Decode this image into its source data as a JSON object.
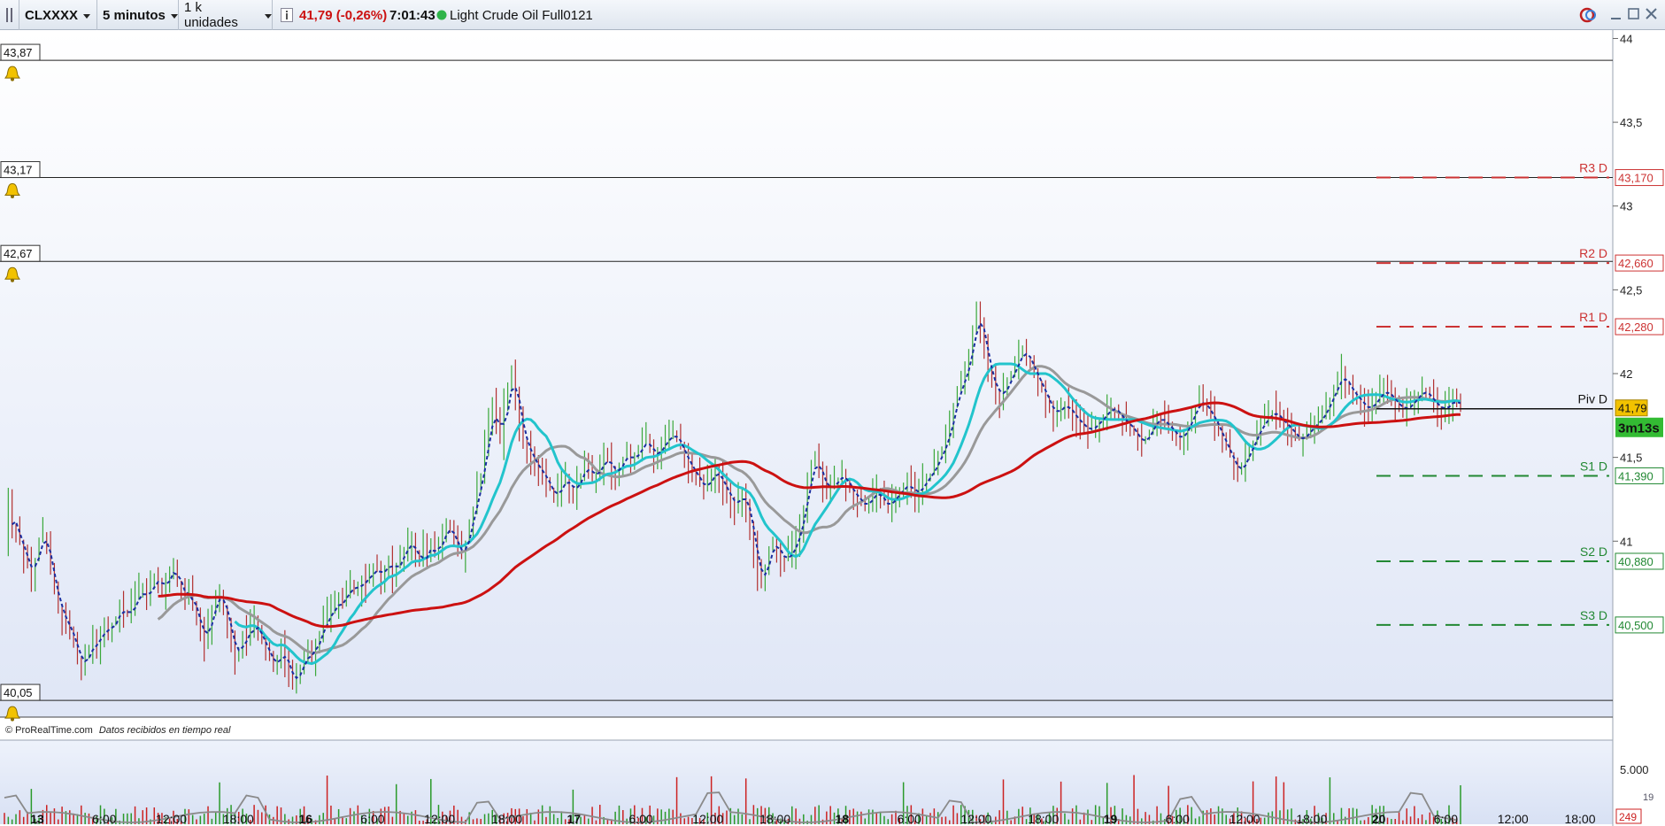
{
  "toolbar": {
    "symbol": "CLXXXX",
    "timeframe": "5 minutos",
    "units": "1 k unidades",
    "price_change": "41,79 (-0,26%)",
    "time": "7:01:43",
    "instrument": "Light Crude Oil Full0121"
  },
  "footer": {
    "source": "© ProRealTime.com",
    "note": "Datos recibidos en tiempo real"
  },
  "countdown": "3m13s",
  "current_price": "41,79",
  "alerts": [
    "43,87",
    "43,17",
    "42,67",
    "40,05"
  ],
  "volume_axis": {
    "tick": "5.000",
    "small_label": "19",
    "current": "249"
  },
  "colors": {
    "accent_red": "#cc1111",
    "resistance": "#cc3333",
    "support": "#228833",
    "cyan": "#22c4cc",
    "gray": "#999999",
    "blue_dash": "#1a2ea0",
    "price_badge": "#f2c200",
    "countdown_bg": "#33bb33"
  },
  "chart_data": {
    "type": "line",
    "y_ticks": [
      "44",
      "43,5",
      "43",
      "42,5",
      "42",
      "41,5",
      "41"
    ],
    "ylim": [
      39.95,
      44.05
    ],
    "x_ticks": [
      {
        "label": "13",
        "bold": true
      },
      {
        "label": "6:00"
      },
      {
        "label": "12:00"
      },
      {
        "label": "18:00"
      },
      {
        "label": "16",
        "bold": true
      },
      {
        "label": "6:00"
      },
      {
        "label": "12:00"
      },
      {
        "label": "18:00"
      },
      {
        "label": "17",
        "bold": true
      },
      {
        "label": "6:00"
      },
      {
        "label": "12:00"
      },
      {
        "label": "18:00"
      },
      {
        "label": "18",
        "bold": true
      },
      {
        "label": "6:00"
      },
      {
        "label": "12:00"
      },
      {
        "label": "18:00"
      },
      {
        "label": "19",
        "bold": true
      },
      {
        "label": "6:00"
      },
      {
        "label": "12:00"
      },
      {
        "label": "18:00"
      },
      {
        "label": "20",
        "bold": true
      },
      {
        "label": "6:00"
      },
      {
        "label": "12:00"
      },
      {
        "label": "18:00"
      }
    ],
    "pivots": [
      {
        "name": "R3 D",
        "value": 43.17,
        "label": "43,170",
        "kind": "resistance"
      },
      {
        "name": "R2 D",
        "value": 42.66,
        "label": "42,660",
        "kind": "resistance"
      },
      {
        "name": "R1 D",
        "value": 42.28,
        "label": "42,280",
        "kind": "resistance"
      },
      {
        "name": "Piv D",
        "value": 41.79,
        "label": "",
        "kind": "pivot"
      },
      {
        "name": "S1 D",
        "value": 41.39,
        "label": "41,390",
        "kind": "support"
      },
      {
        "name": "S2 D",
        "value": 40.88,
        "label": "40,880",
        "kind": "support"
      },
      {
        "name": "S3 D",
        "value": 40.5,
        "label": "40,500",
        "kind": "support"
      }
    ],
    "alert_levels": [
      43.87,
      43.17,
      42.67,
      40.05
    ],
    "price": {
      "x": [
        0,
        2,
        4,
        6,
        8,
        10,
        12,
        14,
        16,
        18,
        20,
        22,
        24,
        26,
        28,
        30,
        32,
        34,
        36,
        38,
        40,
        42,
        44,
        46,
        48,
        50,
        52,
        54,
        56,
        58,
        60,
        62,
        64,
        66,
        68,
        70,
        72,
        74,
        76,
        78,
        80,
        82,
        84,
        86,
        88,
        90,
        92,
        94,
        96,
        98,
        100,
        102,
        104,
        106,
        108,
        110,
        112,
        114,
        116,
        118,
        120,
        122,
        124,
        126,
        128,
        130,
        132,
        134,
        136,
        138,
        140,
        142,
        144,
        146,
        148,
        150,
        152,
        154,
        156,
        158,
        160,
        162,
        164,
        166,
        168,
        170,
        172,
        174,
        176,
        178,
        180,
        182,
        184,
        186,
        188,
        190,
        192,
        194,
        196,
        198,
        200,
        202,
        204,
        206,
        208,
        210,
        212,
        214,
        216,
        218,
        220,
        222,
        224,
        226,
        228,
        230,
        232,
        234,
        236,
        238,
        240,
        242,
        244,
        246,
        248,
        250,
        252,
        254,
        256,
        258,
        260,
        262,
        264,
        266,
        268,
        270,
        272,
        274,
        276,
        278,
        280,
        282,
        284,
        286,
        288,
        290,
        292,
        294,
        296,
        298,
        300,
        302,
        304,
        306,
        308,
        310,
        312,
        314,
        316,
        318,
        320,
        322,
        324,
        326,
        328,
        330,
        332,
        334,
        336,
        338,
        340,
        342,
        344,
        346,
        348,
        350,
        352,
        354,
        356,
        358,
        360,
        362,
        364,
        366,
        368,
        370,
        372,
        374,
        376,
        378,
        380,
        382,
        384,
        386,
        388,
        390,
        392,
        394,
        396,
        398,
        400,
        402,
        404,
        406,
        408,
        410,
        412,
        414,
        416,
        418,
        420,
        422,
        424,
        426,
        428,
        430,
        432,
        434,
        436,
        438,
        440,
        442,
        444,
        446,
        448,
        450,
        452,
        454,
        456,
        458,
        460,
        462,
        464,
        466,
        468,
        470,
        472,
        474,
        476,
        478,
        480,
        482,
        484,
        486,
        488,
        490,
        492,
        494,
        496,
        498,
        500,
        502,
        504,
        506,
        508,
        510,
        512,
        514,
        516,
        518,
        520,
        522,
        524,
        526,
        528,
        530,
        532,
        534,
        536,
        538,
        540,
        542,
        544,
        546,
        548,
        550,
        552,
        554,
        556,
        558,
        560,
        562,
        564,
        566,
        568,
        570,
        572,
        574,
        576,
        578,
        580,
        582,
        584,
        586,
        588,
        590,
        592,
        594,
        596,
        598,
        600,
        602,
        604,
        606,
        608,
        610,
        612,
        614,
        616,
        618,
        620,
        622,
        624,
        626,
        628,
        630,
        632,
        634,
        636,
        638,
        640,
        642,
        644,
        646,
        648,
        650,
        652,
        654,
        656,
        658,
        660,
        662,
        664,
        666,
        668,
        670,
        672,
        674,
        676,
        678,
        680,
        682,
        684,
        686,
        688,
        690,
        692,
        694,
        696,
        698,
        700,
        702,
        704,
        706,
        708,
        710,
        712,
        714,
        716,
        718,
        720,
        722,
        724,
        726,
        728,
        730,
        732,
        734,
        736,
        738,
        740,
        742,
        744,
        746,
        748,
        750,
        752,
        754,
        756,
        758,
        760,
        762,
        764,
        766,
        768,
        770,
        772,
        774,
        776,
        778,
        780,
        782,
        784,
        786,
        788,
        790,
        792,
        794,
        796,
        798,
        800,
        802,
        804,
        806,
        808,
        810,
        812,
        814,
        816,
        818,
        820,
        822,
        824,
        826,
        828,
        830,
        832,
        834,
        836,
        838,
        840,
        842,
        844,
        846,
        848,
        850,
        852,
        854,
        856,
        858,
        860,
        862,
        864,
        866,
        868,
        870,
        872,
        874,
        876,
        878,
        880,
        882,
        884,
        886,
        888,
        890,
        892,
        894,
        896,
        898,
        900,
        902,
        904,
        906,
        908,
        910,
        912,
        914,
        916,
        918,
        920,
        922,
        924,
        926,
        928,
        930,
        932,
        934,
        936,
        938,
        940,
        942,
        944,
        946,
        948,
        950,
        952,
        954,
        956,
        958,
        960,
        962,
        964,
        966,
        968,
        970,
        972,
        974,
        976,
        978,
        980,
        982,
        984,
        986,
        988,
        990,
        992,
        994,
        996,
        998,
        1000,
        1002,
        1004,
        1006,
        1008,
        1010,
        1012,
        1014,
        1016,
        1018,
        1020,
        1022,
        1024,
        1026,
        1028,
        1030,
        1032,
        1034,
        1036,
        1038,
        1040,
        1042,
        1044,
        1046,
        1048,
        1050,
        1052,
        1054,
        1056,
        1058,
        1060,
        1062,
        1064,
        1066,
        1068,
        1070,
        1072,
        1074,
        1076,
        1078,
        1080,
        1082,
        1084,
        1086,
        1088,
        1090,
        1092,
        1094,
        1096,
        1098,
        1100,
        1102,
        1104,
        1106,
        1108,
        1110,
        1112,
        1114,
        1116,
        1118,
        1120,
        1122,
        1124,
        1126,
        1128,
        1130,
        1132,
        1134,
        1136,
        1138,
        1140,
        1142,
        1144,
        1146,
        1148,
        1150,
        1152,
        1154,
        1156,
        1158,
        1160,
        1162,
        1164,
        1166,
        1168,
        1170,
        1172,
        1174,
        1176,
        1178,
        1180,
        1182,
        1184,
        1186,
        1188,
        1190,
        1192,
        1194,
        1196,
        1198,
        1200,
        1202,
        1204,
        1206,
        1208,
        1210,
        1212,
        1214,
        1216,
        1218,
        1220,
        1222,
        1224,
        1226,
        1228,
        1230,
        1232,
        1234,
        1236,
        1238,
        1240,
        1242,
        1244,
        1246,
        1248,
        1250,
        1252,
        1254,
        1256,
        1258,
        1260,
        1262,
        1264,
        1266,
        1268,
        1270,
        1272,
        1274,
        1276,
        1278,
        1280,
        1282,
        1284,
        1286,
        1288,
        1290,
        1292,
        1294,
        1296,
        1298,
        1300,
        1302,
        1304,
        1306,
        1308,
        1310,
        1312,
        1314,
        1316,
        1318,
        1320,
        1322,
        1324,
        1326,
        1328,
        1330,
        1332,
        1334,
        1336,
        1338,
        1340,
        1342,
        1344,
        1346,
        1348,
        1350,
        1352,
        1354,
        1356,
        1358,
        1360,
        1362,
        1364,
        1366,
        1368,
        1370
      ],
      "note_x": "index",
      "y": [
        41.0,
        41.2,
        41.1,
        41.05,
        41.0,
        40.9,
        40.85,
        40.8,
        40.9,
        41.0,
        41.05,
        40.95,
        40.8,
        40.7,
        40.6,
        40.55,
        40.5,
        40.45,
        40.4,
        40.3,
        40.25,
        40.3,
        40.35,
        40.4,
        40.38,
        40.45,
        40.5,
        40.45,
        40.5,
        40.55,
        40.6,
        40.58,
        40.55,
        40.6,
        40.65,
        40.7,
        40.7,
        40.65,
        40.72,
        40.8,
        40.75,
        40.7,
        40.78,
        40.8,
        40.85,
        40.75,
        40.7,
        40.65,
        40.7,
        40.6,
        40.55,
        40.45,
        40.4,
        40.5,
        40.6,
        40.65,
        40.7,
        40.6,
        40.5,
        40.4,
        40.3,
        40.35,
        40.45,
        40.4,
        40.5,
        40.5,
        40.45,
        40.4,
        40.35,
        40.3,
        40.25,
        40.28,
        40.35,
        40.3,
        40.2,
        40.15,
        40.2,
        40.25,
        40.3,
        40.35,
        40.3,
        40.4,
        40.45,
        40.5,
        40.55,
        40.6,
        40.6,
        40.65,
        40.62,
        40.7,
        40.75,
        40.7,
        40.72,
        40.78,
        40.75,
        40.8,
        40.85,
        40.82,
        40.78,
        40.85,
        40.9,
        40.8,
        40.85,
        40.9,
        40.95,
        40.98,
        41.0,
        40.9,
        40.85,
        40.95,
        40.9,
        41.0,
        40.92,
        40.95,
        41.05,
        41.1,
        41.05,
        41.0,
        40.95,
        40.9,
        41.0,
        41.1,
        41.2,
        41.3,
        41.4,
        41.55,
        41.7,
        41.8,
        41.7,
        41.6,
        41.8,
        41.9,
        42.0,
        41.85,
        41.7,
        41.6,
        41.55,
        41.5,
        41.45,
        41.42,
        41.4,
        41.35,
        41.3,
        41.25,
        41.3,
        41.35,
        41.38,
        41.32,
        41.28,
        41.35,
        41.4,
        41.45,
        41.42,
        41.38,
        41.4,
        41.45,
        41.5,
        41.48,
        41.42,
        41.4,
        41.45,
        41.5,
        41.52,
        41.48,
        41.5,
        41.55,
        41.58,
        41.6,
        41.55,
        41.5,
        41.52,
        41.58,
        41.6,
        41.62,
        41.65,
        41.6,
        41.55,
        41.5,
        41.45,
        41.42,
        41.38,
        41.35,
        41.3,
        41.35,
        41.4,
        41.42,
        41.38,
        41.32,
        41.28,
        41.25,
        41.2,
        41.25,
        41.3,
        41.2,
        41.1,
        40.95,
        40.8,
        40.75,
        40.85,
        40.95,
        41.0,
        40.95,
        40.9,
        40.88,
        40.92,
        40.95,
        41.0,
        41.1,
        41.2,
        41.35,
        41.45,
        41.5,
        41.4,
        41.35,
        41.3,
        41.32,
        41.35,
        41.38,
        41.4,
        41.35,
        41.3,
        41.28,
        41.25,
        41.22,
        41.2,
        41.25,
        41.28,
        41.3,
        41.25,
        41.22,
        41.2,
        41.25,
        41.28,
        41.3,
        41.32,
        41.35,
        41.3,
        41.28,
        41.3,
        41.35,
        41.38,
        41.4,
        41.45,
        41.5,
        41.55,
        41.6,
        41.7,
        41.8,
        41.9,
        41.95,
        42.0,
        42.1,
        42.25,
        42.35,
        42.3,
        42.15,
        42.0,
        41.95,
        41.9,
        41.85,
        41.9,
        41.95,
        42.0,
        42.05,
        42.1,
        42.15,
        42.1,
        42.05,
        42.0,
        41.95,
        41.9,
        41.85,
        41.8,
        41.75,
        41.78,
        41.8,
        41.82,
        41.78,
        41.75,
        41.72,
        41.7,
        41.68,
        41.65,
        41.68,
        41.7,
        41.72,
        41.75,
        41.78,
        41.8,
        41.78,
        41.75,
        41.72,
        41.7,
        41.68,
        41.65,
        41.6,
        41.58,
        41.62,
        41.65,
        41.7,
        41.75,
        41.72,
        41.7,
        41.68,
        41.65,
        41.62,
        41.6,
        41.65,
        41.7,
        41.75,
        41.8,
        41.85,
        41.82,
        41.78,
        41.75,
        41.7,
        41.65,
        41.6,
        41.55,
        41.5,
        41.45,
        41.4,
        41.45,
        41.5,
        41.55,
        41.6,
        41.65,
        41.7,
        41.72,
        41.75,
        41.78,
        41.75,
        41.72,
        41.7,
        41.68,
        41.65,
        41.62,
        41.6,
        41.62,
        41.65,
        41.68,
        41.7,
        41.72,
        41.75,
        41.8,
        41.85,
        41.9,
        41.95,
        42.0,
        41.95,
        41.9,
        41.88,
        41.85,
        41.82,
        41.8,
        41.78,
        41.82,
        41.85,
        41.88,
        41.9,
        41.88,
        41.85,
        41.82,
        41.8,
        41.78,
        41.8,
        41.82,
        41.85,
        41.88,
        41.9,
        41.88,
        41.85,
        41.82,
        41.8,
        41.78,
        41.8,
        41.82,
        41.85,
        41.82,
        41.8
      ]
    },
    "volume_note": "Volume histogram with moving average in lower panel"
  }
}
